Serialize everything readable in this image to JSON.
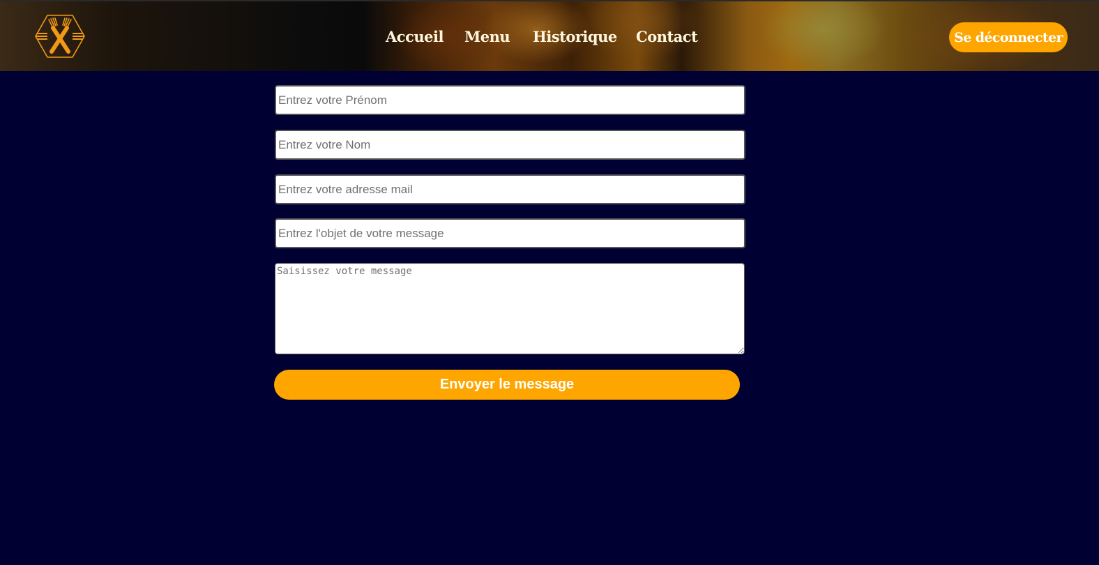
{
  "header": {
    "logo": {
      "icon": "crossed-fork-knife-icon",
      "color": "#f29a16"
    },
    "nav": [
      {
        "label": "Accueil"
      },
      {
        "label": "Menu"
      },
      {
        "label": "Historique"
      },
      {
        "label": "Contact"
      }
    ],
    "logout_label": "Se déconnecter"
  },
  "form": {
    "first_name_placeholder": "Entrez votre Prénom",
    "last_name_placeholder": "Entrez votre Nom",
    "email_placeholder": "Entrez votre adresse mail",
    "subject_placeholder": "Entrez l'objet de votre message",
    "message_placeholder": "Saisissez votre message",
    "submit_label": "Envoyer le message"
  },
  "colors": {
    "accent": "#ffa500",
    "background": "#000032",
    "nav_text": "#fff6dd"
  }
}
